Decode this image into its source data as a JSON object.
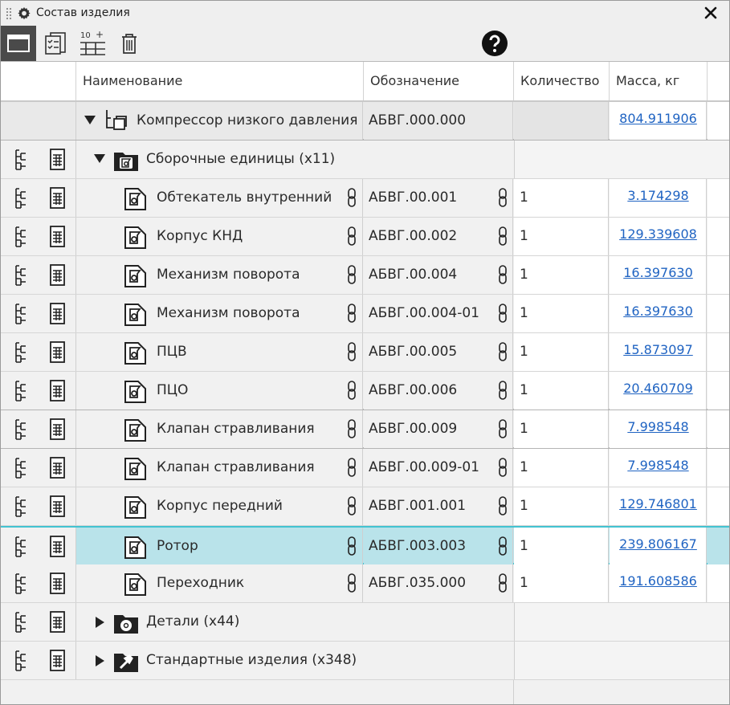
{
  "window": {
    "title": "Состав изделия"
  },
  "columns": {
    "name": "Наименование",
    "designation": "Обозначение",
    "quantity": "Количество",
    "mass": "Масса, кг"
  },
  "root": {
    "name": "Компрессор низкого давления",
    "designation": "АБВГ.000.000",
    "mass": "804.911906"
  },
  "groups": {
    "assemblies": "Сборочные единицы (x11)",
    "parts": "Детали (x44)",
    "standard": "Стандартные изделия (x348)"
  },
  "items": [
    {
      "name": "Обтекатель внутренний",
      "designation": "АБВГ.00.001",
      "quantity": "1",
      "mass": "3.174298"
    },
    {
      "name": "Корпус КНД",
      "designation": "АБВГ.00.002",
      "quantity": "1",
      "mass": "129.339608"
    },
    {
      "name": "Механизм поворота",
      "designation": "АБВГ.00.004",
      "quantity": "1",
      "mass": "16.397630"
    },
    {
      "name": "Механизм поворота",
      "designation": "АБВГ.00.004-01",
      "quantity": "1",
      "mass": "16.397630"
    },
    {
      "name": "ПЦВ",
      "designation": "АБВГ.00.005",
      "quantity": "1",
      "mass": "15.873097"
    },
    {
      "name": "ПЦО",
      "designation": "АБВГ.00.006",
      "quantity": "1",
      "mass": "20.460709"
    },
    {
      "name": "Клапан стравливания",
      "designation": "АБВГ.00.009",
      "quantity": "1",
      "mass": "7.998548"
    },
    {
      "name": "Клапан стравливания",
      "designation": "АБВГ.00.009-01",
      "quantity": "1",
      "mass": "7.998548"
    },
    {
      "name": "Корпус передний",
      "designation": "АБВГ.001.001",
      "quantity": "1",
      "mass": "129.746801"
    },
    {
      "name": "Ротор",
      "designation": "АБВГ.003.003",
      "quantity": "1",
      "mass": "239.806167"
    },
    {
      "name": "Переходник",
      "designation": "АБВГ.035.000",
      "quantity": "1",
      "mass": "191.608586"
    }
  ],
  "toolbar": {
    "b1": "10",
    "b1_plus": "+"
  },
  "icons": [
    "gear-icon",
    "close-icon",
    "panel-view-icon",
    "checklist-icon",
    "insert-position-icon",
    "trash-icon",
    "help-icon",
    "tree-structure-icon",
    "document-icon",
    "assembly-icon",
    "link-icon",
    "folder-assembly-icon",
    "folder-parts-icon",
    "folder-standard-icon"
  ],
  "colors": {
    "selection": "#b9e3ea",
    "selection_border": "#43c3d1",
    "link": "#1f63c2",
    "active_tool": "#4a4a4a"
  }
}
